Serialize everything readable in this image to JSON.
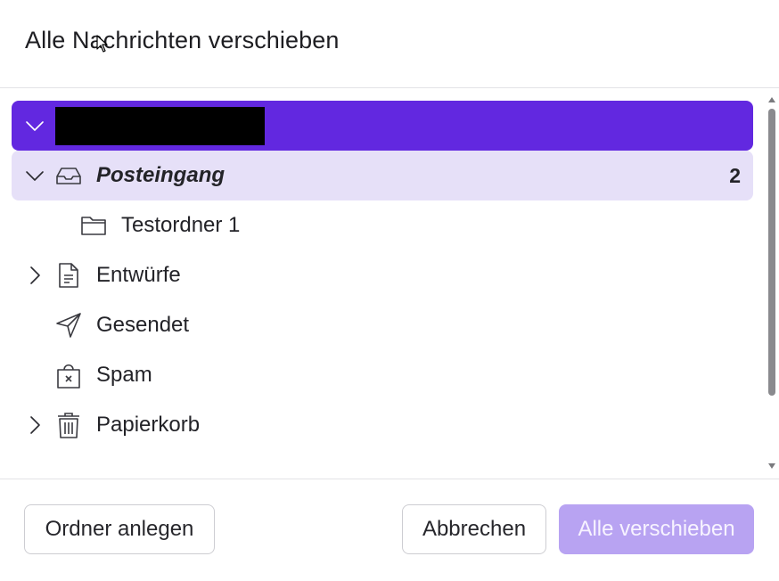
{
  "dialog": {
    "title": "Alle Nachrichten verschieben"
  },
  "tree": {
    "account": {
      "label_redacted": true
    },
    "folders": [
      {
        "label": "Posteingang",
        "count": "2",
        "icon": "inbox-icon",
        "expanded": true,
        "selected": true
      },
      {
        "label": "Testordner 1",
        "icon": "folder-icon"
      },
      {
        "label": "Entwürfe",
        "icon": "drafts-icon",
        "expanded": false
      },
      {
        "label": "Gesendet",
        "icon": "sent-icon"
      },
      {
        "label": "Spam",
        "icon": "spam-icon"
      },
      {
        "label": "Papierkorb",
        "icon": "trash-icon",
        "expanded": false
      }
    ]
  },
  "footer": {
    "create_folder": "Ordner anlegen",
    "cancel": "Abbrechen",
    "move_all": "Alle verschieben"
  },
  "colors": {
    "accent": "#6228e0",
    "selected_bg": "#e6e0f8",
    "primary_disabled": "#b8a3f2"
  }
}
